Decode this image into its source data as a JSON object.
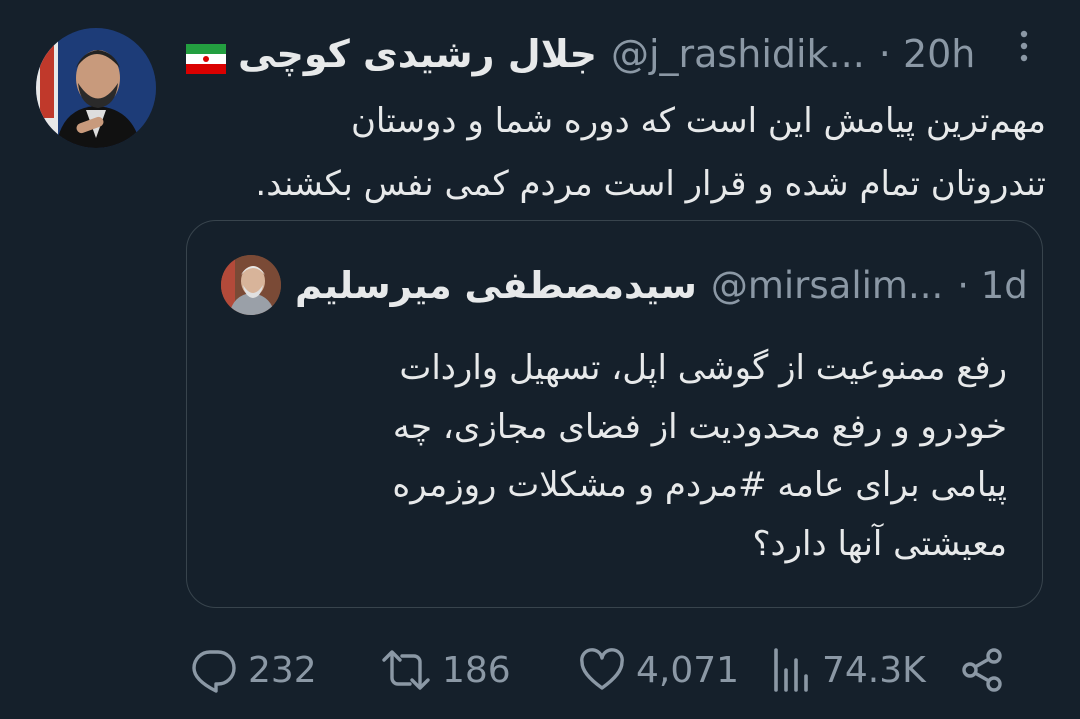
{
  "tweet": {
    "author_name": "جلال رشیدی کوچی",
    "flag": "🇮🇷",
    "handle": "@j_rashidik...",
    "time": "· 20h",
    "text_lines": [
      "مهم‌ترین پیامش این است که دوره شما و دوستان",
      "تندروتان تمام شده و قرار است مردم کمی نفس بکشند."
    ]
  },
  "quoted_tweet": {
    "author_name": "سیدمصطفی میرسلیم",
    "handle": "@mirsalim...",
    "time": "· 1d",
    "text_lines": [
      "رفع ممنوعیت از گوشی اپل، تسهیل واردات",
      "خودرو و رفع محدودیت از فضای مجازی، چه",
      "پیامی برای عامه #مردم و مشکلات روزمره",
      "معیشتی آنها دارد؟"
    ]
  },
  "actions": {
    "reply_count": "232",
    "retweet_count": "186",
    "like_count": "4,071",
    "views_count": "74.3K"
  },
  "icons": {
    "reply": "reply-icon",
    "retweet": "retweet-icon",
    "like": "heart-icon",
    "views": "views-icon",
    "share": "share-icon",
    "more": "more-icon"
  },
  "colors": {
    "background": "#15202b",
    "text": "#e7e9ea",
    "secondary": "#8b98a5",
    "border": "#38444d"
  }
}
